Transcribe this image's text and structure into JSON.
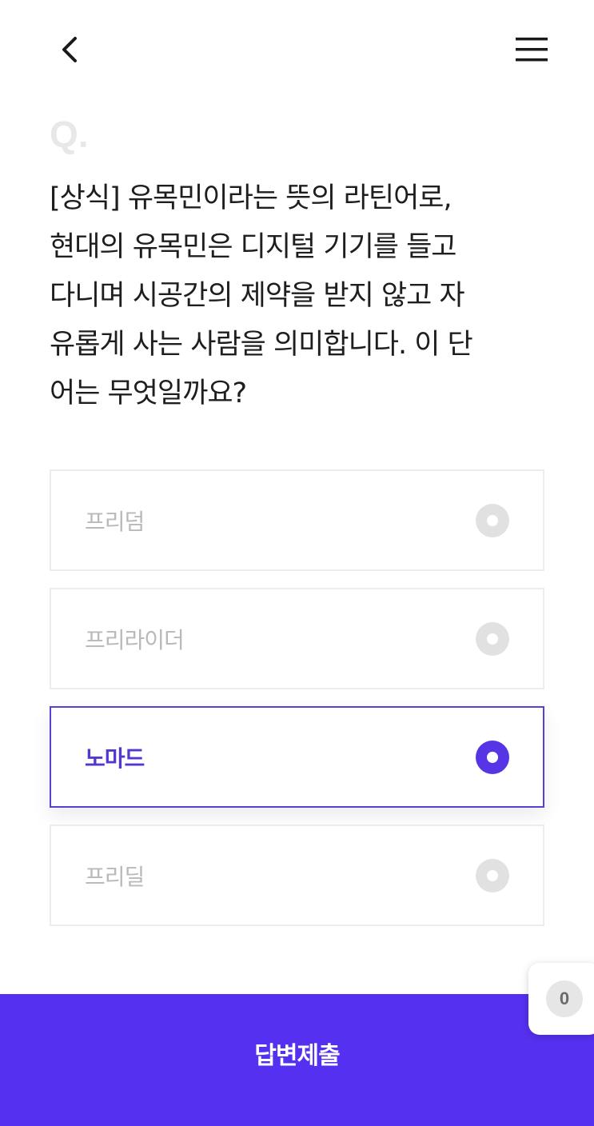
{
  "header": {
    "back_icon": "chevron-left-icon",
    "menu_icon": "hamburger-menu-icon"
  },
  "quiz": {
    "q_mark": "Q.",
    "question_lines": [
      "[상식] 유목민이라는 뜻의 라틴어로,",
      "현대의 유목민은 디지털 기기를 들고",
      "다니며 시공간의 제약을 받지 않고 자",
      "유롭게 사는 사람을 의미합니다. 이 단",
      "어는 무엇일까요?"
    ],
    "options": [
      {
        "label": "프리덤",
        "selected": false
      },
      {
        "label": "프리라이더",
        "selected": false
      },
      {
        "label": "노마드",
        "selected": true
      },
      {
        "label": "프리딜",
        "selected": false
      }
    ]
  },
  "floating_counter": {
    "value": "0"
  },
  "submit": {
    "label": "답변제출"
  },
  "colors": {
    "accent": "#5530f0",
    "selected_text": "#5337d0",
    "unselected_text": "#b9b9b9",
    "radio_inactive": "#e1e1e1"
  }
}
